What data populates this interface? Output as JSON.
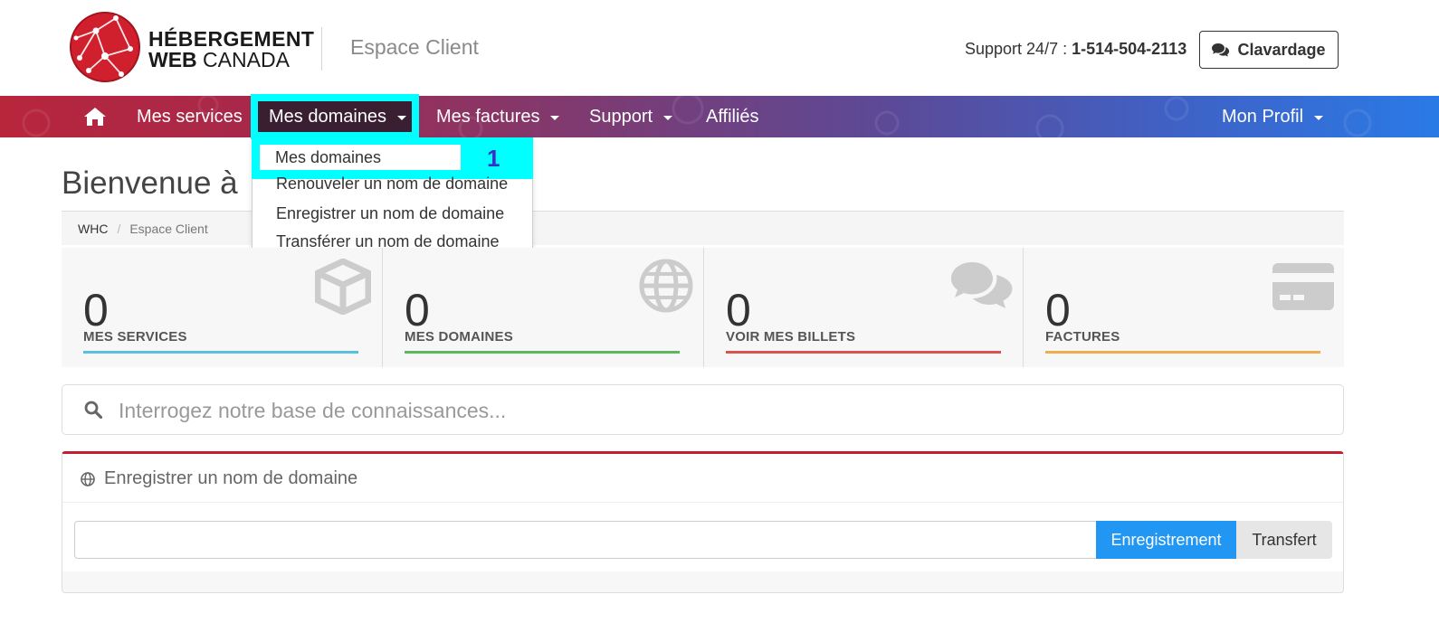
{
  "header": {
    "brand_line1": "HÉBERGEMENT",
    "brand_line2_bold": "WEB",
    "brand_line2_rest": " CANADA",
    "portal_name": "Espace Client",
    "support_label": "Support 24/7 : ",
    "support_phone": "1-514-504-2113",
    "chat_label": "Clavardage"
  },
  "nav": {
    "items": [
      {
        "label": "Mes services"
      },
      {
        "label": "Mes domaines"
      },
      {
        "label": "Mes factures"
      },
      {
        "label": "Support"
      },
      {
        "label": "Affiliés"
      }
    ],
    "profile_label": "Mon Profil"
  },
  "dropdown": {
    "items": [
      {
        "label": "Mes domaines"
      },
      {
        "label": "Renouveler un nom de domaine"
      },
      {
        "label": "Enregistrer un nom de domaine"
      },
      {
        "label": "Transférer un nom de domaine"
      }
    ],
    "step_marker": "1"
  },
  "page": {
    "welcome": "Bienvenue à ",
    "breadcrumb": [
      "WHC",
      "Espace Client"
    ]
  },
  "tiles": [
    {
      "count": "0",
      "label": "MES SERVICES",
      "color": "#5bc0de",
      "icon": "cube-icon"
    },
    {
      "count": "0",
      "label": "MES DOMAINES",
      "color": "#5cb85c",
      "icon": "globe-icon"
    },
    {
      "count": "0",
      "label": "VOIR MES BILLETS",
      "color": "#d9534f",
      "icon": "comments-icon"
    },
    {
      "count": "0",
      "label": "FACTURES",
      "color": "#f0ad4e",
      "icon": "credit-card-icon"
    }
  ],
  "kb_search": {
    "placeholder": "Interrogez notre base de connaissances..."
  },
  "domain_panel": {
    "title": "Enregistrer un nom de domaine",
    "register_label": "Enregistrement",
    "transfer_label": "Transfert"
  }
}
